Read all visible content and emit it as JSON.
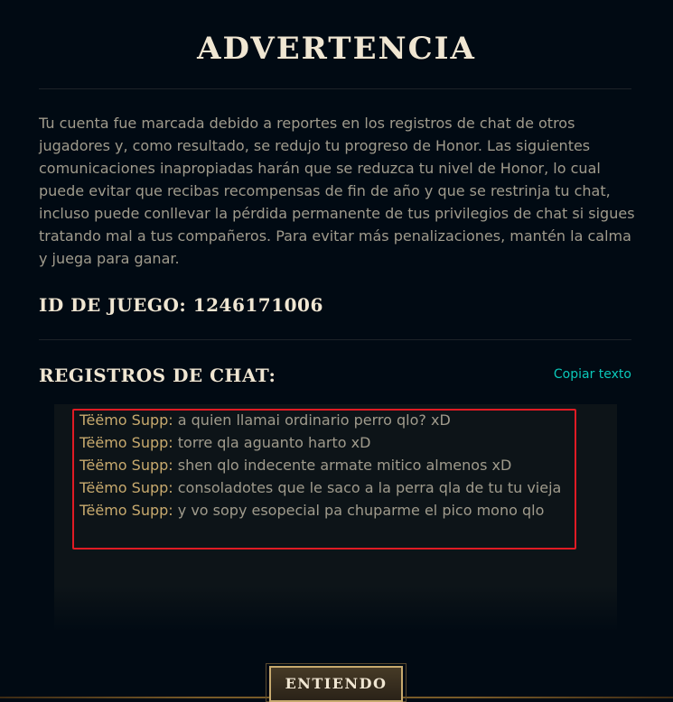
{
  "dialog": {
    "title": "ADVERTENCIA",
    "message": "Tu cuenta fue marcada debido a reportes en los registros de chat de otros jugadores y, como resultado, se redujo tu progreso de Honor. Las siguientes comunicaciones inapropiadas harán que se reduzca tu nivel de Honor, lo cual puede evitar que recibas recompensas de fin de año y que se restrinja tu chat, incluso puede conllevar la pérdida permanente de tus privilegios de chat si sigues tratando mal a tus compañeros. Para evitar más penalizaciones, mantén la calma y juega para ganar.",
    "game_id_label": "ID DE JUEGO: 1246171006",
    "chat_heading": "REGISTROS DE CHAT:",
    "copy_text": "Copiar texto",
    "button_label": "ENTIENDO"
  },
  "chat_log": [
    {
      "speaker": "Tëëmo Supp:",
      "message": " a quien llamai ordinario perro qlo? xD"
    },
    {
      "speaker": "Tëëmo Supp:",
      "message": " torre qla aguanto harto xD"
    },
    {
      "speaker": "Tëëmo Supp:",
      "message": " shen qlo indecente armate mitico almenos xD"
    },
    {
      "speaker": "Tëëmo Supp:",
      "message": " consoladotes que le saco a la perra qla de tu tu vieja"
    },
    {
      "speaker": "Tëëmo Supp:",
      "message": " y vo sopy esopecial pa chuparme el pico mono qlo"
    }
  ],
  "colors": {
    "background": "#010a13",
    "gold": "#c8aa6e",
    "title": "#f0e6d2",
    "link": "#0ac8b9",
    "highlight_box": "#e01b24"
  }
}
